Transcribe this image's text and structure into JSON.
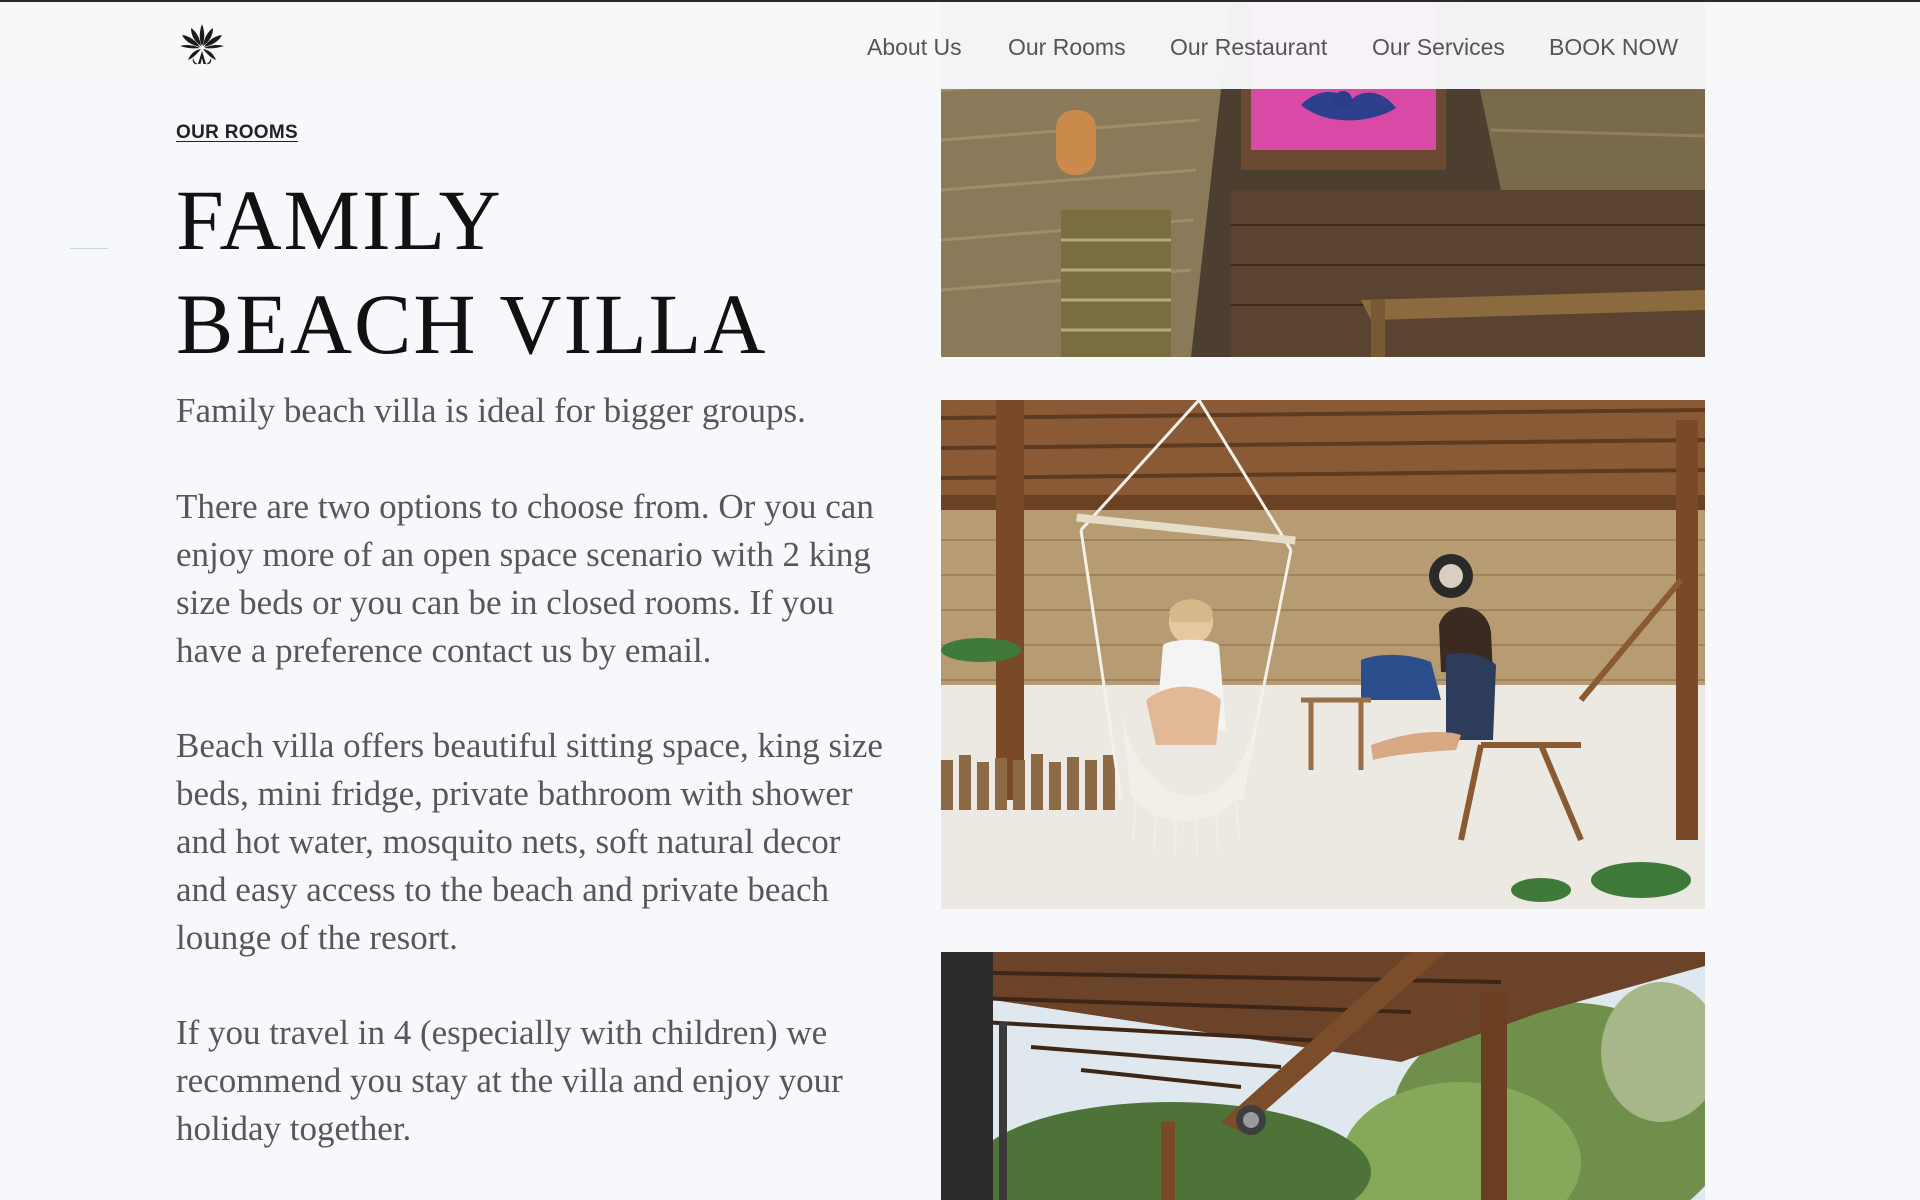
{
  "header": {
    "logo": {
      "icon": "lotus-flower-icon"
    },
    "nav": [
      {
        "label": "About Us"
      },
      {
        "label": "Our Rooms"
      },
      {
        "label": "Our Restaurant"
      },
      {
        "label": "Our Services"
      },
      {
        "label": "BOOK NOW"
      }
    ]
  },
  "main": {
    "eyebrow": "OUR ROOMS",
    "title_line1": "FAMILY",
    "title_line2": "BEACH VILLA",
    "paragraphs": [
      "Family beach villa is ideal for bigger groups.",
      "There are two options to choose from. Or you can enjoy more of an open space scenario with 2 king size beds or you can be in closed rooms. If you have a preference contact us by email.",
      "Beach villa offers beautiful sitting space, king size beds, mini fridge, private bathroom with shower and hot water, mosquito nets, soft natural decor and easy access to the beach and private beach lounge of the resort.",
      "If you travel in 4 (especially with children) we recommend you stay at the villa and enjoy your holiday together."
    ]
  },
  "gallery": [
    {
      "icon": "villa-bedroom-photo"
    },
    {
      "icon": "hammock-lounge-photo"
    },
    {
      "icon": "villa-terrace-photo"
    }
  ]
}
